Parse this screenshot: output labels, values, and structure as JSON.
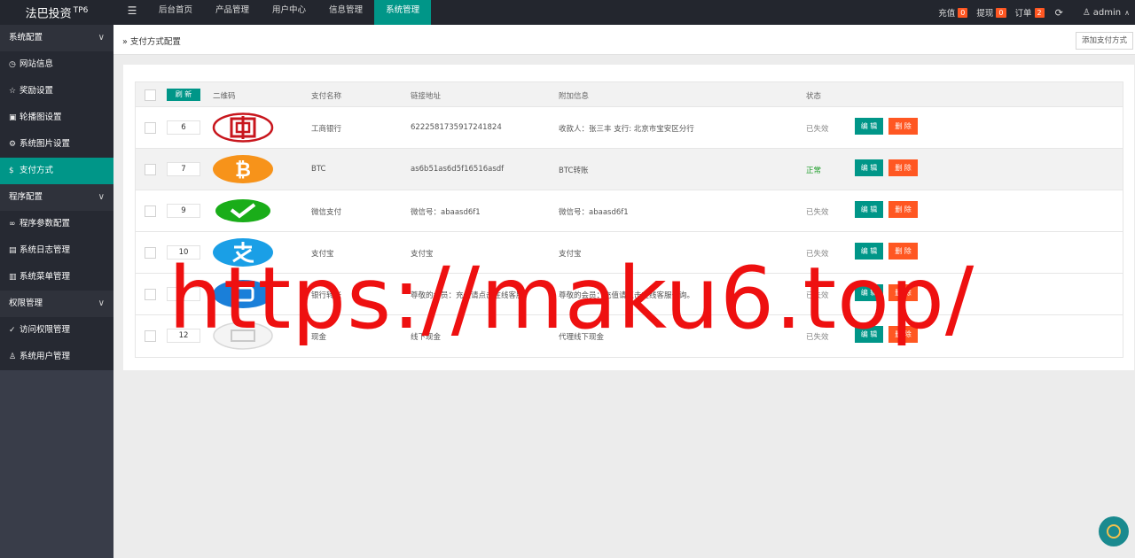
{
  "brand": {
    "name": "法巴投资",
    "version": "TP6"
  },
  "topnav": {
    "toggle_icon": "☰",
    "items": [
      "后台首页",
      "产品管理",
      "用户中心",
      "信息管理",
      "系统管理"
    ],
    "active_index": 4
  },
  "topright": {
    "recharge_label": "充值",
    "recharge_count": "0",
    "withdraw_label": "提现",
    "withdraw_count": "0",
    "order_label": "订单",
    "order_count": "2",
    "user": "admin"
  },
  "sidebar": {
    "groups": [
      {
        "label": "系统配置",
        "items": [
          {
            "label": "网站信息",
            "icon": "dashboard-icon"
          },
          {
            "label": "奖励设置",
            "icon": "star-icon"
          },
          {
            "label": "轮播图设置",
            "icon": "image-icon"
          },
          {
            "label": "系统图片设置",
            "icon": "gear-icon"
          },
          {
            "label": "支付方式",
            "icon": "dollar-icon",
            "active": true
          }
        ]
      },
      {
        "label": "程序配置",
        "items": [
          {
            "label": "程序参数配置",
            "icon": "link-icon"
          },
          {
            "label": "系统日志管理",
            "icon": "document-icon"
          },
          {
            "label": "系统菜单管理",
            "icon": "list-icon"
          }
        ]
      },
      {
        "label": "权限管理",
        "items": [
          {
            "label": "访问权限管理",
            "icon": "check-circle-icon"
          },
          {
            "label": "系统用户管理",
            "icon": "user-icon"
          }
        ]
      }
    ]
  },
  "breadcrumb": "支付方式配置",
  "add_button": "添加支付方式",
  "table": {
    "headers": {
      "refresh": "刷 新",
      "qrcode": "二维码",
      "name": "支付名称",
      "link": "链接地址",
      "extra": "附加信息",
      "status": "状态"
    },
    "edit_label": "编 辑",
    "delete_label": "删 除",
    "rows": [
      {
        "sort": "6",
        "logo": "icbc",
        "name": "工商银行",
        "link": "6222581735917241824",
        "extra": "收款人：张三丰 支行: 北京市宝安区分行",
        "status": "已失效",
        "ok": false
      },
      {
        "sort": "7",
        "logo": "btc",
        "name": "BTC",
        "link": "as6b51as6d5f16516asdf",
        "extra": "BTC转账",
        "status": "正常",
        "ok": true
      },
      {
        "sort": "9",
        "logo": "wechat",
        "name": "微信支付",
        "link": "微信号：abaasd6f1",
        "extra": "微信号：abaasd6f1",
        "status": "已失效",
        "ok": false
      },
      {
        "sort": "10",
        "logo": "alipay",
        "name": "支付宝",
        "link": "支付宝",
        "extra": "支付宝",
        "status": "已失效",
        "ok": false
      },
      {
        "sort": "",
        "logo": "blue",
        "name": "银行转账",
        "link": "尊敬的会员：充值请点击在线客服",
        "extra": "尊敬的会员：充值请点击在线客服咨询。",
        "status": "已失效",
        "ok": false
      },
      {
        "sort": "12",
        "logo": "cash",
        "name": "现金",
        "link": "线下现金",
        "extra": "代理线下现金",
        "status": "已失效",
        "ok": false
      }
    ]
  },
  "watermark": "https://maku6.top/"
}
